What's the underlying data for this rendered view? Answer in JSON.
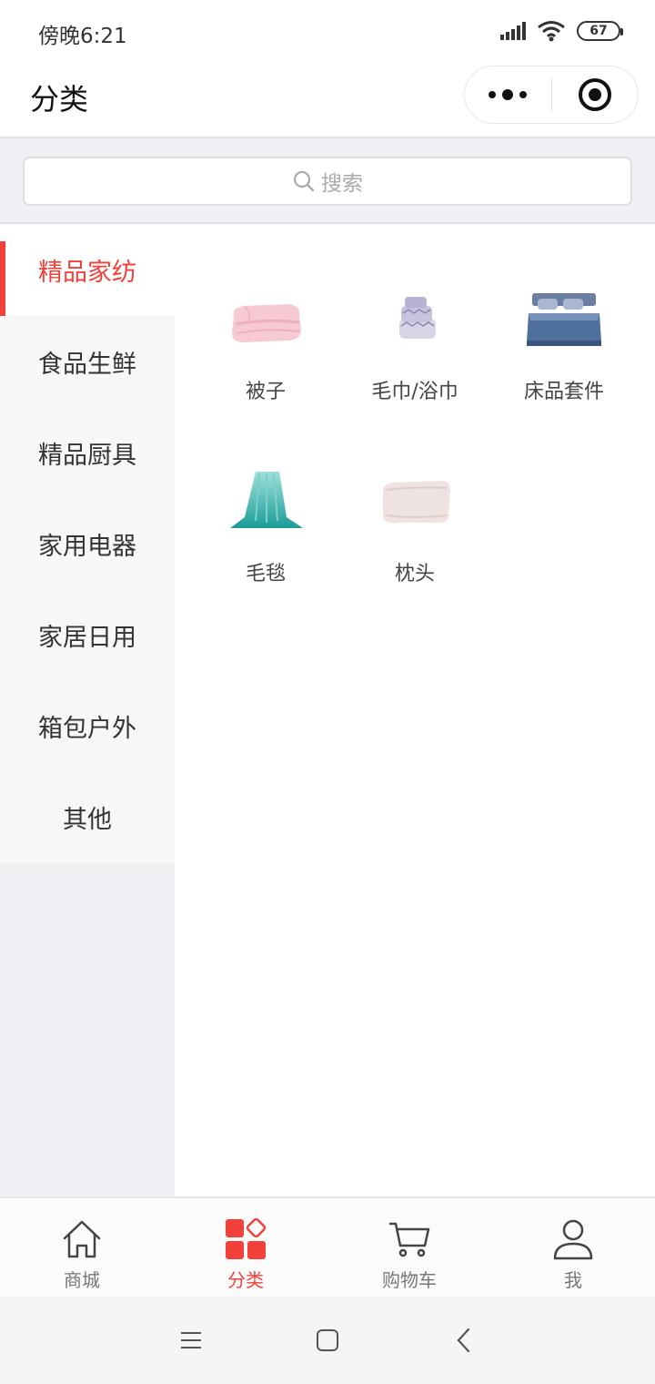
{
  "status": {
    "time": "傍晚6:21",
    "battery": "67"
  },
  "nav": {
    "title": "分类"
  },
  "search": {
    "placeholder": "搜索"
  },
  "sidebar": {
    "items": [
      {
        "label": "精品家纺",
        "active": true
      },
      {
        "label": "食品生鲜"
      },
      {
        "label": "精品厨具"
      },
      {
        "label": "家用电器"
      },
      {
        "label": "家居日用"
      },
      {
        "label": "箱包户外"
      },
      {
        "label": "其他"
      }
    ]
  },
  "products": [
    {
      "label": "被子",
      "icon": "quilt-image"
    },
    {
      "label": "毛巾/浴巾",
      "icon": "towel-image"
    },
    {
      "label": "床品套件",
      "icon": "bedding-set-image"
    },
    {
      "label": "毛毯",
      "icon": "blanket-image"
    },
    {
      "label": "枕头",
      "icon": "pillow-image"
    }
  ],
  "tabs": [
    {
      "label": "商城",
      "icon": "home-icon"
    },
    {
      "label": "分类",
      "icon": "category-icon",
      "active": true
    },
    {
      "label": "购物车",
      "icon": "cart-icon"
    },
    {
      "label": "我",
      "icon": "user-icon"
    }
  ],
  "colors": {
    "accent": "#f2403a",
    "sidebar_bg": "#f7f7f7",
    "page_bg": "#efeff4"
  }
}
